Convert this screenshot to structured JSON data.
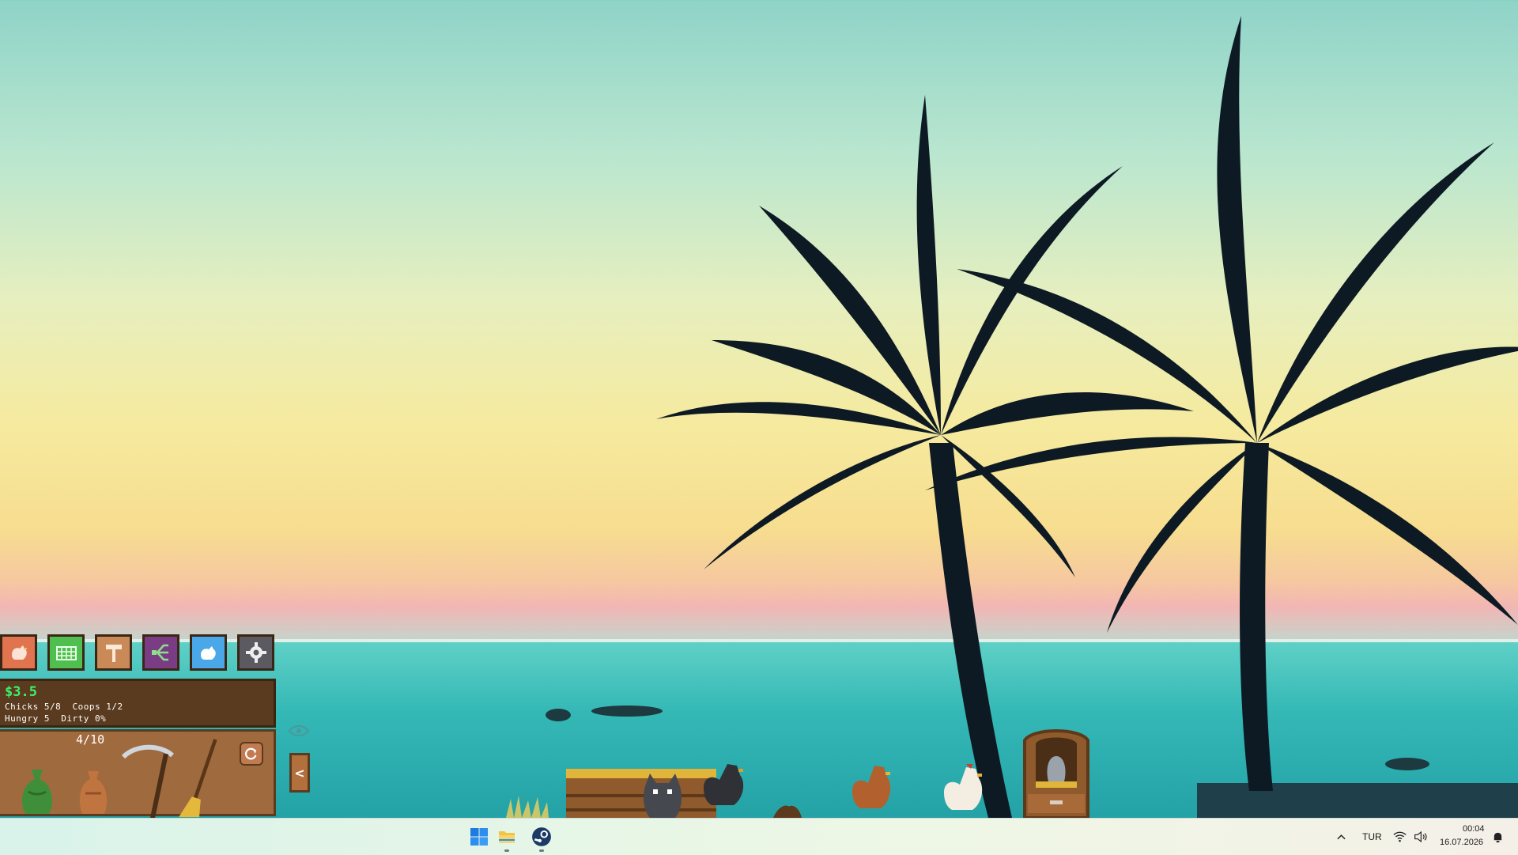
{
  "game": {
    "money": "$3.5",
    "stats_line1": "Chicks 5/8  Coops 1/2",
    "stats_line2": "Hungry 5  Dirty 0%",
    "inventory_count": "4/10",
    "toolbar": [
      {
        "name": "chicken-button",
        "icon": "chicken-icon",
        "color": "#e0744f"
      },
      {
        "name": "feed-basket-button",
        "icon": "basket-icon",
        "color": "#4fbf4f"
      },
      {
        "name": "build-hammer-button",
        "icon": "hammer-icon",
        "color": "#c98a58"
      },
      {
        "name": "upgrade-tree-button",
        "icon": "tree-icon",
        "color": "#7a3d84"
      },
      {
        "name": "bird-shop-button",
        "icon": "bird-icon",
        "color": "#4aa8e8"
      },
      {
        "name": "settings-button",
        "icon": "gear-icon",
        "color": "#5a5a60"
      }
    ]
  },
  "taskbar": {
    "language": "TUR",
    "time": "00:04",
    "date": "16.07.2026"
  }
}
